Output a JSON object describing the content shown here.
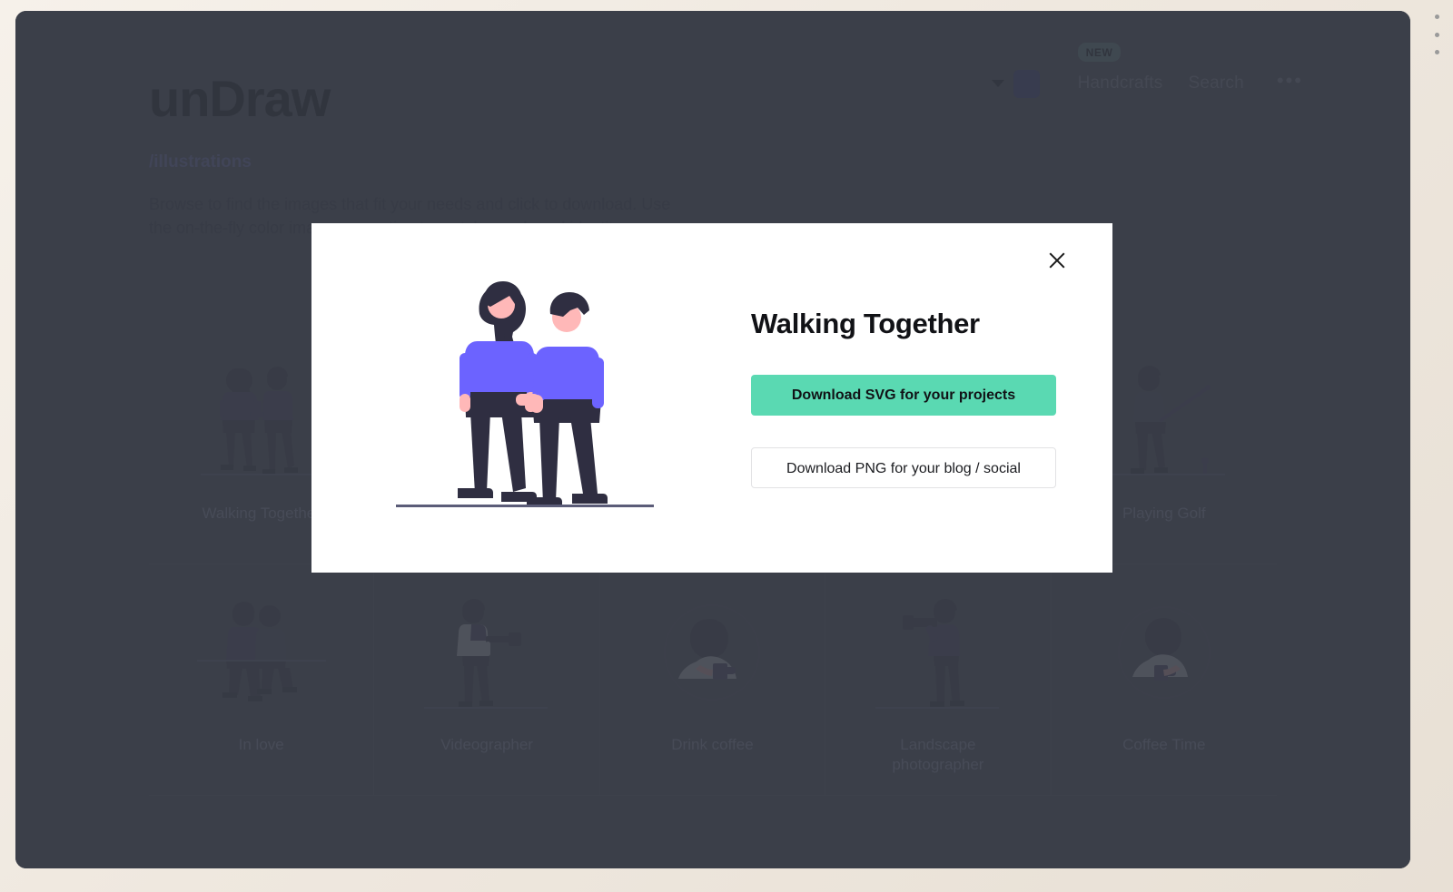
{
  "window": {
    "menu_icon": "vertical-dots-icon"
  },
  "header": {
    "logo": "unDraw",
    "subtitle": "/illustrations",
    "description": "Browse to find the images that fit your needs and click to download. Use the on-the-fly color image generation to match your brand identity."
  },
  "nav": {
    "color_swatch_hex": "#3b3e5e",
    "caret_icon": "chevron-down-icon",
    "new_badge": "NEW",
    "links": [
      {
        "label": "Handcrafts"
      },
      {
        "label": "Search"
      }
    ],
    "more_label": "•••"
  },
  "grid": {
    "items": [
      {
        "label": "Walking Together",
        "art": "walking"
      },
      {
        "label": "",
        "art": "blank"
      },
      {
        "label": "",
        "art": "blank"
      },
      {
        "label": "",
        "art": "blank"
      },
      {
        "label": "Playing Golf",
        "art": "golf"
      },
      {
        "label": "In love",
        "art": "inlove"
      },
      {
        "label": "Videographer",
        "art": "videographer"
      },
      {
        "label": "Drink coffee",
        "art": "drinkcoffee"
      },
      {
        "label": "Landscape photographer",
        "art": "photographer"
      },
      {
        "label": "Coffee Time",
        "art": "coffeetime"
      }
    ]
  },
  "modal": {
    "title": "Walking Together",
    "close_icon": "close-icon",
    "primary_button": "Download SVG for your projects",
    "secondary_button": "Download PNG for your blog / social",
    "primary_color_hex": "#5ad9b2",
    "illustration": {
      "name": "walking-together-illustration",
      "accent_hex": "#6c63ff",
      "dark_hex": "#2f2e41",
      "skin_hex": "#ffb8b8"
    }
  }
}
